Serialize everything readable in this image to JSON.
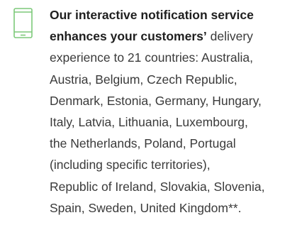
{
  "feature": {
    "icon": "mobile-phone-icon",
    "icon_color": "#7dc97a",
    "bold_lines": [
      "Our interactive notification service",
      "enhances your customers’"
    ],
    "line2_rest": " delivery",
    "lines": [
      "experience to 21 countries: Australia,",
      "Austria, Belgium, Czech Republic,",
      "Denmark, Estonia, Germany, Hungary,",
      "Italy, Latvia, Lithuania, Luxembourg,",
      "the Netherlands, Poland, Portugal",
      "(including specific territories),",
      "Republic of Ireland, Slovakia, Slovenia,",
      "Spain, Sweden, United Kingdom**."
    ]
  }
}
